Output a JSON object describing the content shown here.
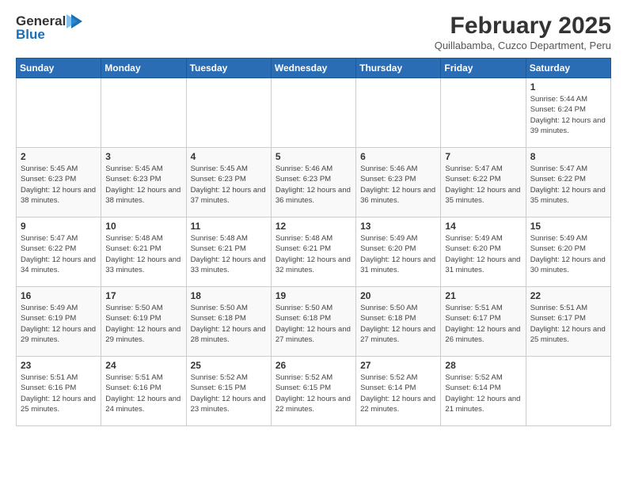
{
  "logo": {
    "general": "General",
    "blue": "Blue"
  },
  "title": "February 2025",
  "subtitle": "Quillabamba, Cuzco Department, Peru",
  "weekdays": [
    "Sunday",
    "Monday",
    "Tuesday",
    "Wednesday",
    "Thursday",
    "Friday",
    "Saturday"
  ],
  "weeks": [
    [
      {
        "day": "",
        "info": ""
      },
      {
        "day": "",
        "info": ""
      },
      {
        "day": "",
        "info": ""
      },
      {
        "day": "",
        "info": ""
      },
      {
        "day": "",
        "info": ""
      },
      {
        "day": "",
        "info": ""
      },
      {
        "day": "1",
        "info": "Sunrise: 5:44 AM\nSunset: 6:24 PM\nDaylight: 12 hours and 39 minutes."
      }
    ],
    [
      {
        "day": "2",
        "info": "Sunrise: 5:45 AM\nSunset: 6:23 PM\nDaylight: 12 hours and 38 minutes."
      },
      {
        "day": "3",
        "info": "Sunrise: 5:45 AM\nSunset: 6:23 PM\nDaylight: 12 hours and 38 minutes."
      },
      {
        "day": "4",
        "info": "Sunrise: 5:45 AM\nSunset: 6:23 PM\nDaylight: 12 hours and 37 minutes."
      },
      {
        "day": "5",
        "info": "Sunrise: 5:46 AM\nSunset: 6:23 PM\nDaylight: 12 hours and 36 minutes."
      },
      {
        "day": "6",
        "info": "Sunrise: 5:46 AM\nSunset: 6:23 PM\nDaylight: 12 hours and 36 minutes."
      },
      {
        "day": "7",
        "info": "Sunrise: 5:47 AM\nSunset: 6:22 PM\nDaylight: 12 hours and 35 minutes."
      },
      {
        "day": "8",
        "info": "Sunrise: 5:47 AM\nSunset: 6:22 PM\nDaylight: 12 hours and 35 minutes."
      }
    ],
    [
      {
        "day": "9",
        "info": "Sunrise: 5:47 AM\nSunset: 6:22 PM\nDaylight: 12 hours and 34 minutes."
      },
      {
        "day": "10",
        "info": "Sunrise: 5:48 AM\nSunset: 6:21 PM\nDaylight: 12 hours and 33 minutes."
      },
      {
        "day": "11",
        "info": "Sunrise: 5:48 AM\nSunset: 6:21 PM\nDaylight: 12 hours and 33 minutes."
      },
      {
        "day": "12",
        "info": "Sunrise: 5:48 AM\nSunset: 6:21 PM\nDaylight: 12 hours and 32 minutes."
      },
      {
        "day": "13",
        "info": "Sunrise: 5:49 AM\nSunset: 6:20 PM\nDaylight: 12 hours and 31 minutes."
      },
      {
        "day": "14",
        "info": "Sunrise: 5:49 AM\nSunset: 6:20 PM\nDaylight: 12 hours and 31 minutes."
      },
      {
        "day": "15",
        "info": "Sunrise: 5:49 AM\nSunset: 6:20 PM\nDaylight: 12 hours and 30 minutes."
      }
    ],
    [
      {
        "day": "16",
        "info": "Sunrise: 5:49 AM\nSunset: 6:19 PM\nDaylight: 12 hours and 29 minutes."
      },
      {
        "day": "17",
        "info": "Sunrise: 5:50 AM\nSunset: 6:19 PM\nDaylight: 12 hours and 29 minutes."
      },
      {
        "day": "18",
        "info": "Sunrise: 5:50 AM\nSunset: 6:18 PM\nDaylight: 12 hours and 28 minutes."
      },
      {
        "day": "19",
        "info": "Sunrise: 5:50 AM\nSunset: 6:18 PM\nDaylight: 12 hours and 27 minutes."
      },
      {
        "day": "20",
        "info": "Sunrise: 5:50 AM\nSunset: 6:18 PM\nDaylight: 12 hours and 27 minutes."
      },
      {
        "day": "21",
        "info": "Sunrise: 5:51 AM\nSunset: 6:17 PM\nDaylight: 12 hours and 26 minutes."
      },
      {
        "day": "22",
        "info": "Sunrise: 5:51 AM\nSunset: 6:17 PM\nDaylight: 12 hours and 25 minutes."
      }
    ],
    [
      {
        "day": "23",
        "info": "Sunrise: 5:51 AM\nSunset: 6:16 PM\nDaylight: 12 hours and 25 minutes."
      },
      {
        "day": "24",
        "info": "Sunrise: 5:51 AM\nSunset: 6:16 PM\nDaylight: 12 hours and 24 minutes."
      },
      {
        "day": "25",
        "info": "Sunrise: 5:52 AM\nSunset: 6:15 PM\nDaylight: 12 hours and 23 minutes."
      },
      {
        "day": "26",
        "info": "Sunrise: 5:52 AM\nSunset: 6:15 PM\nDaylight: 12 hours and 22 minutes."
      },
      {
        "day": "27",
        "info": "Sunrise: 5:52 AM\nSunset: 6:14 PM\nDaylight: 12 hours and 22 minutes."
      },
      {
        "day": "28",
        "info": "Sunrise: 5:52 AM\nSunset: 6:14 PM\nDaylight: 12 hours and 21 minutes."
      },
      {
        "day": "",
        "info": ""
      }
    ]
  ]
}
